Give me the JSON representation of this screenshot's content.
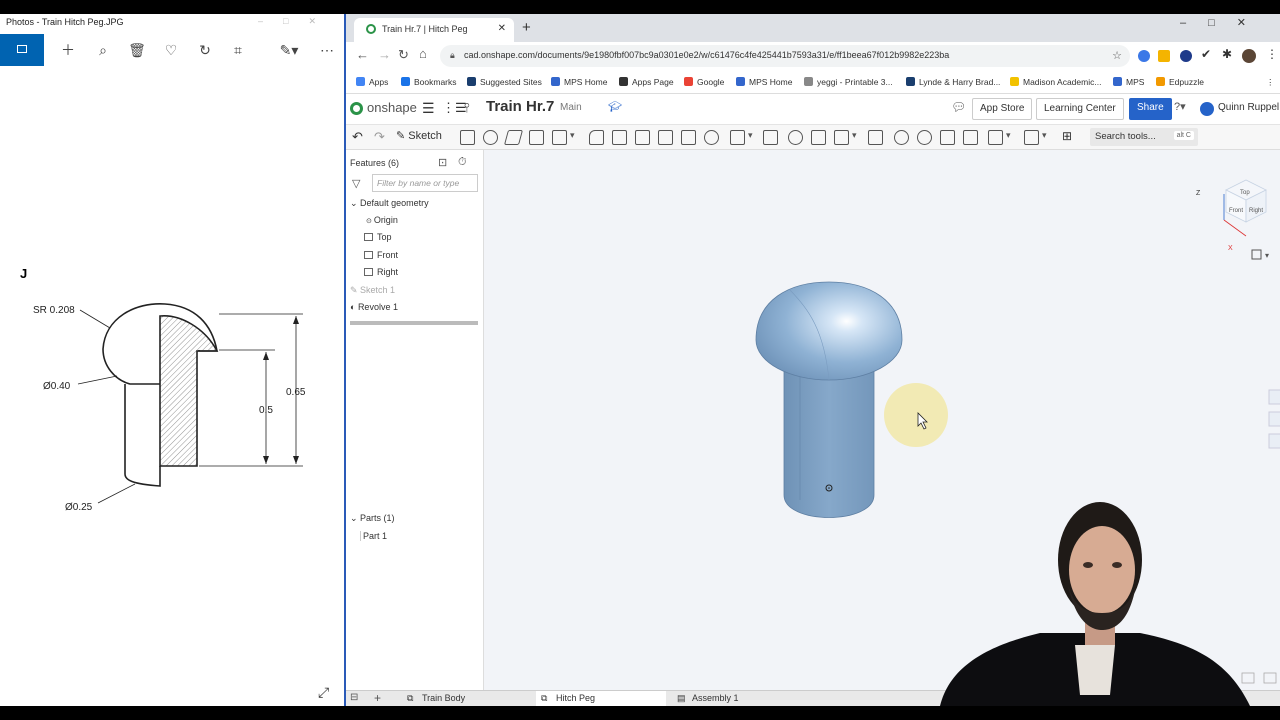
{
  "photos": {
    "title": "Photos - Train Hitch Peg.JPG",
    "drawing": {
      "sr_label": "SR 0.208",
      "dia_head": "Ø0.40",
      "dia_shank": "Ø0.25",
      "dim_shank": "0.5",
      "dim_total": "0.65"
    },
    "toolbar_icons": [
      "image-icon",
      "add-icon",
      "zoom-icon",
      "delete-icon",
      "heart-icon",
      "rotate-icon",
      "crop-icon",
      "edit-icon",
      "more-icon"
    ]
  },
  "browser": {
    "tab_title": "Train Hr.7 | Hitch Peg",
    "url": "cad.onshape.com/documents/9e1980fbf007bc9a0301e0e2/w/c61476c4fe425441b7593a31/e/ff1beea67f012b9982e223ba",
    "bookmarks": [
      {
        "label": "Apps",
        "color": "#4285f4"
      },
      {
        "label": "Bookmarks",
        "color": "#1a73e8"
      },
      {
        "label": "Suggested Sites",
        "color": "#1a3e6e"
      },
      {
        "label": "MPS Home",
        "color": "#3366cc"
      },
      {
        "label": "Apps Page",
        "color": "#333333"
      },
      {
        "label": "Google",
        "color": "#ea4335"
      },
      {
        "label": "MPS Home",
        "color": "#3366cc"
      },
      {
        "label": "yeggi - Printable 3...",
        "color": "#888888"
      },
      {
        "label": "Lynde & Harry Brad...",
        "color": "#1a3e6e"
      },
      {
        "label": "Madison Academic...",
        "color": "#f2c200"
      },
      {
        "label": "MPS",
        "color": "#3366cc"
      },
      {
        "label": "Edpuzzle",
        "color": "#f29900"
      }
    ]
  },
  "onshape": {
    "logo": "onshape",
    "doc_title": "Train Hr.7",
    "branch": "Main",
    "app_store": "App Store",
    "learning_center": "Learning Center",
    "share": "Share",
    "user": "Quinn Ruppel",
    "sketch_label": "Sketch",
    "search_tools": "Search tools...",
    "search_shortcut": "alt C",
    "features_header": "Features (6)",
    "filter_placeholder": "Filter by name or type",
    "default_geometry": "Default geometry",
    "origin": "Origin",
    "planes": [
      "Top",
      "Front",
      "Right"
    ],
    "sketch1": "Sketch 1",
    "revolve1": "Revolve 1",
    "parts_header": "Parts (1)",
    "part1": "Part 1",
    "viewcube": {
      "top": "Top",
      "front": "Front",
      "right": "Right",
      "z": "Z",
      "x": "X"
    },
    "tabs": [
      "Train Body",
      "Hitch Peg",
      "Assembly 1"
    ],
    "active_tab": "Hitch Peg",
    "colors": {
      "part": "#7fa3c8",
      "accent": "#2563c9"
    }
  }
}
